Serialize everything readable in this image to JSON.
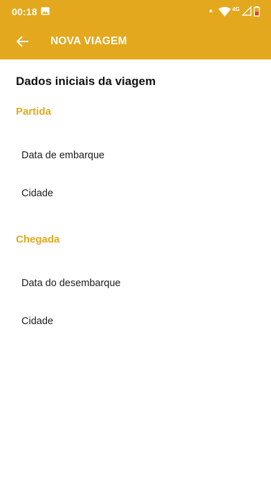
{
  "status_bar": {
    "time": "00:18",
    "network": "4G",
    "icons": [
      "gallery-icon",
      "notification-dot",
      "wifi-icon",
      "signal-icon",
      "battery-icon"
    ]
  },
  "app_bar": {
    "title": "NOVA VIAGEM",
    "back_icon": "arrow-left-icon"
  },
  "form": {
    "section_title": "Dados iniciais da viagem",
    "partida": {
      "label": "Partida",
      "date_field": "Data de embarque",
      "city_field": "Cidade"
    },
    "chegada": {
      "label": "Chegada",
      "date_field": "Data do desembarque",
      "city_field": "Cidade"
    }
  },
  "colors": {
    "accent": "#E3A81E",
    "text": "#111111",
    "background": "#FFFFFF",
    "battery_warning": "#E53935"
  }
}
